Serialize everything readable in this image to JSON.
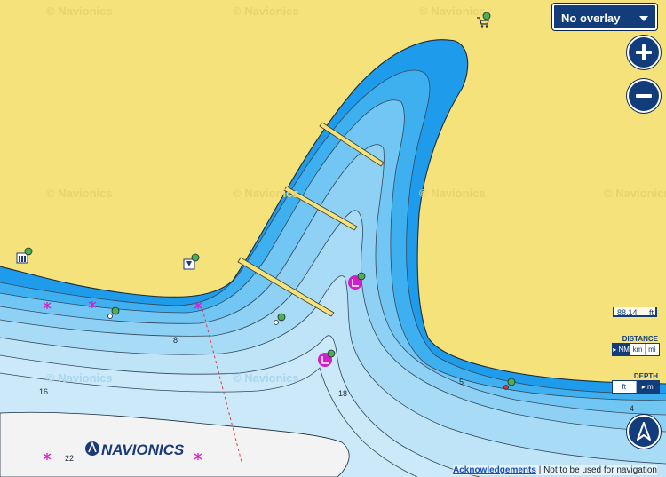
{
  "map": {
    "watermark": "© Navionics",
    "soundings": [
      "8",
      "16",
      "18",
      "22",
      "5",
      "4"
    ],
    "logo": "NAVIONICS"
  },
  "controls": {
    "overlay_label": "No overlay",
    "zoom_in": "+",
    "zoom_out": "−"
  },
  "scale_bar": {
    "value": "88.14",
    "unit": "ft"
  },
  "distance": {
    "title": "DISTANCE",
    "options": [
      "NM",
      "km",
      "mi"
    ],
    "selected": "NM"
  },
  "depth": {
    "title": "DEPTH",
    "options": [
      "ft",
      "m"
    ],
    "selected": "m"
  },
  "footer": {
    "link": "Acknowledgements",
    "notice": "| Not to be used for navigation"
  },
  "colors": {
    "land": "#f5e27a",
    "deep_water": "#c8e6f7",
    "shallow_water": "#1e9bea",
    "ui_navy": "#123d7a"
  },
  "icons": [
    "shopping-cart-icon",
    "fuel-icon",
    "marina-icon",
    "anchorage-icon",
    "harbor-icon"
  ]
}
